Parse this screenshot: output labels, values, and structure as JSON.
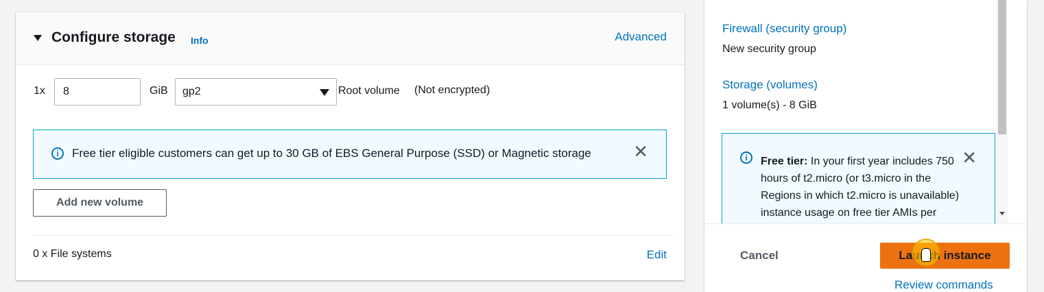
{
  "storage": {
    "title": "Configure storage",
    "info_link": "Info",
    "advanced_link": "Advanced",
    "count_label": "1x",
    "size_value": "8",
    "unit_label": "GiB",
    "volume_type": "gp2",
    "volume_desc": "Root volume",
    "encryption": "(Not encrypted)",
    "alert_text": "Free tier eligible customers can get up to 30 GB of EBS General Purpose (SSD) or Magnetic storage",
    "add_volume_button": "Add new volume",
    "file_systems_label": "0 x File systems",
    "edit_link": "Edit"
  },
  "summary": {
    "firewall_key": "Firewall (security group)",
    "firewall_value": "New security group",
    "storage_key": "Storage (volumes)",
    "storage_value": "1 volume(s) - 8 GiB",
    "free_tier_bold": "Free tier:",
    "free_tier_text": " In your first year includes 750 hours of t2.micro (or t3.micro in the Regions in which t2.micro is unavailable) instance usage on free tier AMIs per month"
  },
  "footer": {
    "cancel": "Cancel",
    "launch": "Launch instance",
    "review": "Review commands"
  },
  "colors": {
    "link": "#0073bb",
    "primary_button": "#ec7211",
    "info_border": "#00a1c9",
    "info_bg": "#f1faff"
  },
  "icons": [
    "caret-down-icon",
    "info-icon",
    "close-icon",
    "dropdown-arrow-icon"
  ]
}
